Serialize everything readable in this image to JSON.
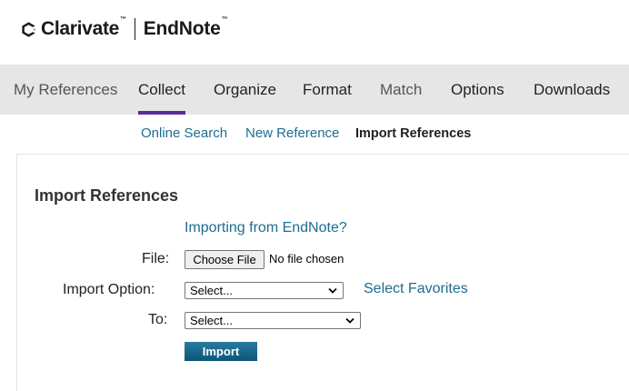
{
  "header": {
    "brand": "Clarivate",
    "product": "EndNote",
    "trademark": "™"
  },
  "nav": {
    "items": [
      {
        "label": "My References"
      },
      {
        "label": "Collect",
        "active": true
      },
      {
        "label": "Organize"
      },
      {
        "label": "Format"
      },
      {
        "label": "Match"
      },
      {
        "label": "Options"
      },
      {
        "label": "Downloads"
      }
    ]
  },
  "subnav": {
    "items": [
      {
        "label": "Online Search"
      },
      {
        "label": "New Reference"
      },
      {
        "label": "Import References",
        "active": true
      }
    ]
  },
  "import_form": {
    "title": "Import References",
    "endnote_link": "Importing from EndNote?",
    "file_label": "File:",
    "file_button": "Choose File",
    "file_status": "No file chosen",
    "option_label": "Import Option:",
    "option_value": "Select...",
    "favorites_link": "Select Favorites",
    "to_label": "To:",
    "to_value": "Select...",
    "import_button": "Import"
  },
  "colors": {
    "accent_underline": "#5a2ca0",
    "link": "#1e6c91",
    "nav_bg": "#e6e6e6",
    "button_blue": "#0b5578"
  }
}
